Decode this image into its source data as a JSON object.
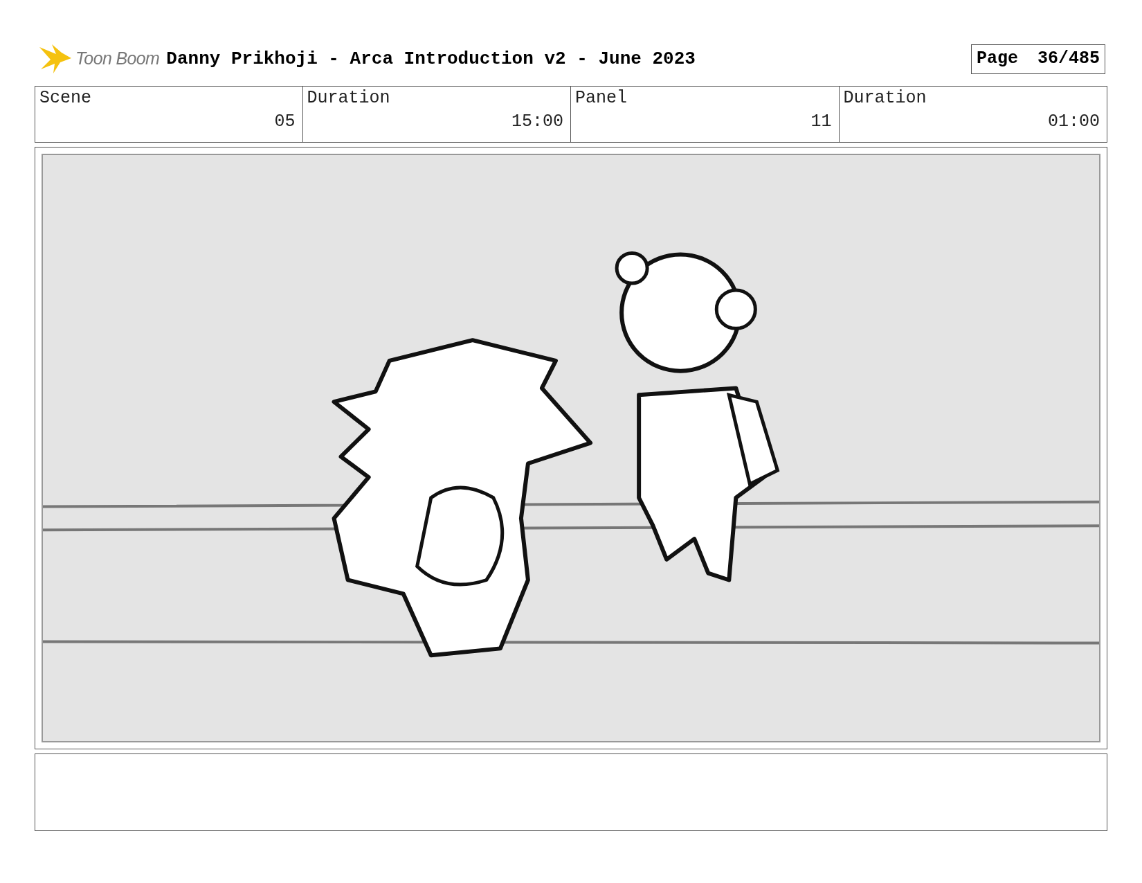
{
  "logo": {
    "text": "Toon Boom"
  },
  "title": "Danny Prikhoji - Arca Introduction v2 - June 2023",
  "page": {
    "label": "Page",
    "number": "36/485"
  },
  "info": {
    "headings": [
      "Scene",
      "Duration",
      "Panel",
      "Duration"
    ],
    "readings": [
      "05",
      "15:00",
      "11",
      "01:00"
    ]
  }
}
